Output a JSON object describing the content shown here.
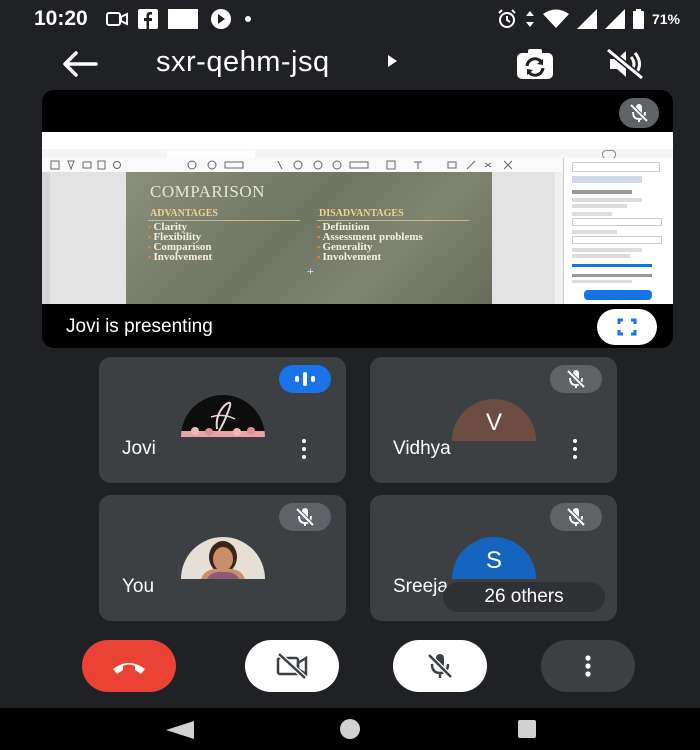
{
  "status_bar": {
    "time": "10:20",
    "battery": "71%"
  },
  "top_bar": {
    "meeting_code": "sxr-qehm-jsq"
  },
  "presentation": {
    "presenting_text": "Jovi is presenting",
    "slide": {
      "title": "COMPARISON",
      "advantages_heading": "ADVANTAGES",
      "advantages": [
        "Clarity",
        "Flexibility",
        "Comparison",
        "Involvement"
      ],
      "disadvantages_heading": "DISADVANTAGES",
      "disadvantages": [
        "Definition",
        "Assessment problems",
        "Generality",
        "Involvement"
      ]
    }
  },
  "participants": [
    {
      "name": "Jovi"
    },
    {
      "name": "Vidhya",
      "initial": "V",
      "color": "#6d4c41"
    },
    {
      "name": "You"
    },
    {
      "name": "Sreeja",
      "initial": "S",
      "color": "#1565c0"
    }
  ],
  "others_count": "26 others",
  "colors": {
    "leave": "#ea4335",
    "speaking": "#1a73e8",
    "tile": "#3c4043",
    "background": "#202124"
  }
}
